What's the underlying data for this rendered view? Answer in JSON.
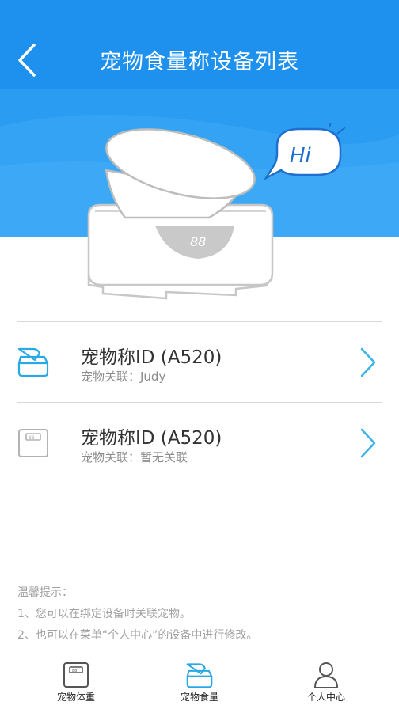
{
  "header": {
    "title": "宠物食量称设备列表"
  },
  "devices": [
    {
      "name": "宠物称ID (A520)",
      "pet": "宠物关联：Judy",
      "icon": "bowl-icon"
    },
    {
      "name": "宠物称ID (A520)",
      "pet": "宠物关联：暂无关联",
      "icon": "scale-icon"
    }
  ],
  "illustration": {
    "bubble_text": "Hi",
    "display_text": "88"
  },
  "tips": {
    "title": "温馨提示：",
    "line1": "1、您可以在绑定设备时关联宠物。",
    "line2": "2、也可以在菜单“个人中心”的设备中进行修改。"
  },
  "tabbar": {
    "items": [
      {
        "label": "宠物体重",
        "icon": "scale-icon"
      },
      {
        "label": "宠物食量",
        "icon": "bowl-icon",
        "active": true
      },
      {
        "label": "个人中心",
        "icon": "person-icon"
      }
    ]
  },
  "colors": {
    "brand": "#1e90ee",
    "accent_icon": "#29a8e6",
    "muted": "#a2a2a2"
  }
}
